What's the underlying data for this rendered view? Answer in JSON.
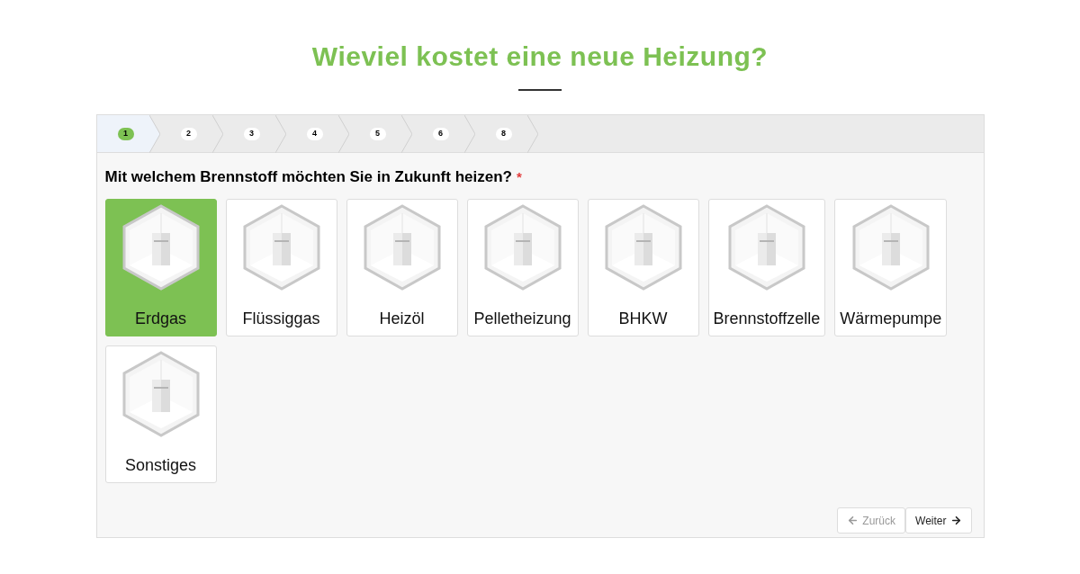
{
  "title": "Wieviel kostet eine neue Heizung?",
  "steps": [
    {
      "label": "1",
      "selected": true
    },
    {
      "label": "2",
      "selected": false
    },
    {
      "label": "3",
      "selected": false
    },
    {
      "label": "4",
      "selected": false
    },
    {
      "label": "5",
      "selected": false
    },
    {
      "label": "6",
      "selected": false
    },
    {
      "label": "8",
      "selected": false
    }
  ],
  "question": {
    "text": "Mit welchem Brennstoff möchten Sie in Zukunft heizen?",
    "required_mark": "*"
  },
  "options": [
    {
      "label": "Erdgas",
      "selected": true
    },
    {
      "label": "Flüssiggas",
      "selected": false
    },
    {
      "label": "Heizöl",
      "selected": false
    },
    {
      "label": "Pelletheizung",
      "selected": false
    },
    {
      "label": "BHKW",
      "selected": false
    },
    {
      "label": "Brennstoffzelle",
      "selected": false
    },
    {
      "label": "Wärmepumpe",
      "selected": false
    },
    {
      "label": "Sonstiges",
      "selected": false
    }
  ],
  "buttons": [
    {
      "label": "Zurück",
      "kind": "back",
      "disabled": true
    },
    {
      "label": "Weiter",
      "kind": "next",
      "disabled": false
    }
  ]
}
